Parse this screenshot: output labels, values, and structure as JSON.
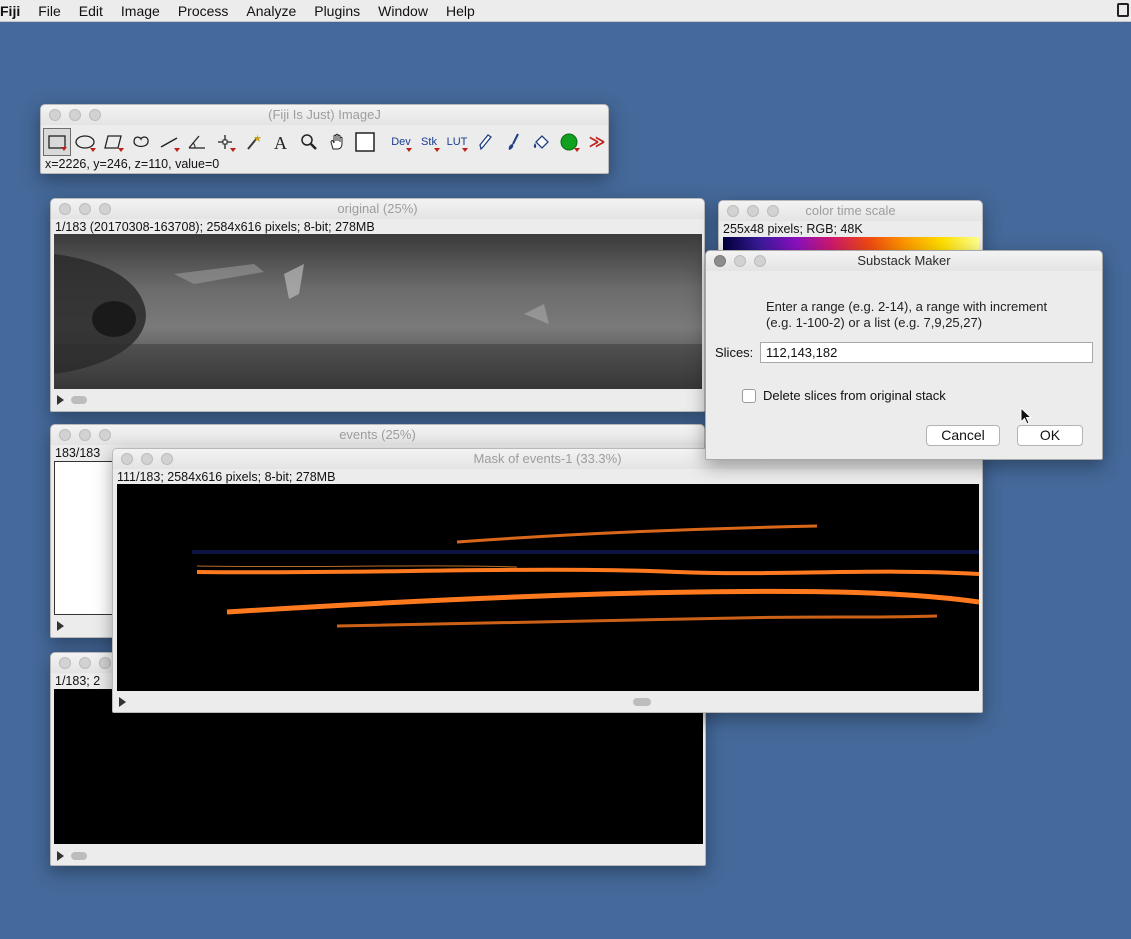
{
  "menubar": {
    "app": "Fiji",
    "items": [
      "File",
      "Edit",
      "Image",
      "Process",
      "Analyze",
      "Plugins",
      "Window",
      "Help"
    ]
  },
  "toolbar_window": {
    "title": "(Fiji Is Just) ImageJ",
    "status": "x=2226, y=246, z=110, value=0",
    "tools": {
      "dev": "Dev",
      "stk": "Stk",
      "lut": "LUT",
      "more": "≫"
    }
  },
  "original_window": {
    "title": "original (25%)",
    "info": "1/183 (20170308-163708); 2584x616 pixels; 8-bit; 278MB"
  },
  "events_window": {
    "title": "events (25%)",
    "info": "183/183"
  },
  "third_window": {
    "info": "1/183; 2"
  },
  "mask_window": {
    "title": "Mask of events-1 (33.3%)",
    "info": "111/183; 2584x616 pixels; 8-bit; 278MB"
  },
  "color_window": {
    "title": "color time scale",
    "info": "255x48 pixels; RGB; 48K"
  },
  "dialog": {
    "title": "Substack Maker",
    "message_line1": "Enter a range (e.g. 2-14), a range with increment",
    "message_line2": "(e.g. 1-100-2) or a list (e.g. 7,9,25,27)",
    "slices_label": "Slices:",
    "slices_value": "112,143,182",
    "checkbox_label": "Delete slices from original stack",
    "checkbox_checked": false,
    "cancel": "Cancel",
    "ok": "OK"
  },
  "colors": {
    "desktop": "#44699a",
    "ok_accent": "#ffffff",
    "mask_orange": "#ff7a1e"
  }
}
